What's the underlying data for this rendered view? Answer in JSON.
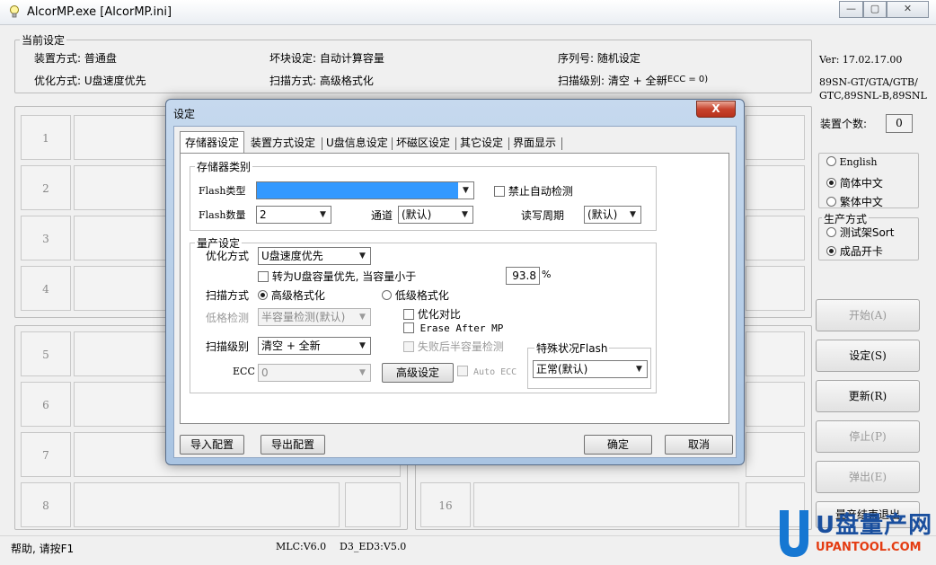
{
  "window": {
    "title": "AlcorMP.exe [AlcorMP.ini]",
    "min_label": "—",
    "max_label": "▢",
    "close_label": "✕"
  },
  "current_settings": {
    "legend": "当前设定",
    "device_mode": "装置方式: 普通盘",
    "bad_block": "坏块设定: 自动计算容量",
    "serial": "序列号: 随机设定",
    "optimize": "优化方式: U盘速度优先",
    "scan_mode": "扫描方式: 高级格式化",
    "scan_level": "扫描级别: 清空 + 全新",
    "ecc_note": "(ECC = 0)"
  },
  "version": {
    "ver": "Ver: 17.02.17.00",
    "models_1": "89SN-GT/GTA/GTB/",
    "models_2": "GTC,89SNL-B,89SNL"
  },
  "device_count": {
    "label": "装置个数:",
    "value": "0"
  },
  "language": {
    "options": [
      "English",
      "简体中文",
      "繁体中文"
    ],
    "selected": 1
  },
  "production": {
    "legend": "生产方式",
    "options": [
      "测试架Sort",
      "成品开卡"
    ],
    "selected": 1
  },
  "side_buttons": {
    "start": "开始(A)",
    "settings": "设定(S)",
    "refresh": "更新(R)",
    "stop": "停止(P)",
    "eject": "弹出(E)",
    "extra": "量产结束退出"
  },
  "slots": [
    "1",
    "2",
    "3",
    "4",
    "5",
    "6",
    "7",
    "8",
    "16"
  ],
  "status": {
    "help": "帮助, 请按F1",
    "mlc": "MLC:V6.0",
    "d3": "D3_ED3:V5.0"
  },
  "watermark": {
    "brand": "U盘量产网",
    "url": "UPANTOOL.COM"
  },
  "dialog": {
    "title": "设定",
    "close_label": "X",
    "tabs": [
      "存储器设定",
      "装置方式设定",
      "U盘信息设定",
      "坏磁区设定",
      "其它设定",
      "界面显示"
    ],
    "storage": {
      "legend": "存储器类别",
      "flash_type_label": "Flash类型",
      "flash_type_value": "",
      "disable_autodetect": "禁止自动检测",
      "flash_count_label": "Flash数量",
      "flash_count_value": "2",
      "channel_label": "通道",
      "channel_value": "(默认)",
      "rw_cycle_label": "读写周期",
      "rw_cycle_value": "(默认)"
    },
    "production": {
      "legend": "量产设定",
      "optimize_label": "优化方式",
      "optimize_value": "U盘速度优先",
      "capacity_priority": "转为U盘容量优先, 当容量小于",
      "capacity_value": "93.8",
      "percent": "%",
      "scan_mode_label": "扫描方式",
      "scan_high": "高级格式化",
      "scan_low": "低级格式化",
      "low_check_label": "低格检测",
      "low_check_value": "半容量检测(默认)",
      "optimize_compare": "优化对比",
      "erase_after_mp": "Erase After MP",
      "fail_half": "失败后半容量检测",
      "scan_level_label": "扫描级别",
      "scan_level_value": "清空 + 全新",
      "ecc_label": "ECC",
      "ecc_value": "0",
      "advanced_button": "高级设定",
      "auto_ecc": "Auto ECC",
      "special_flash_legend": "特殊状况Flash",
      "special_flash_value": "正常(默认)"
    },
    "import_button": "导入配置",
    "export_button": "导出配置",
    "ok_button": "确定",
    "cancel_button": "取消"
  }
}
